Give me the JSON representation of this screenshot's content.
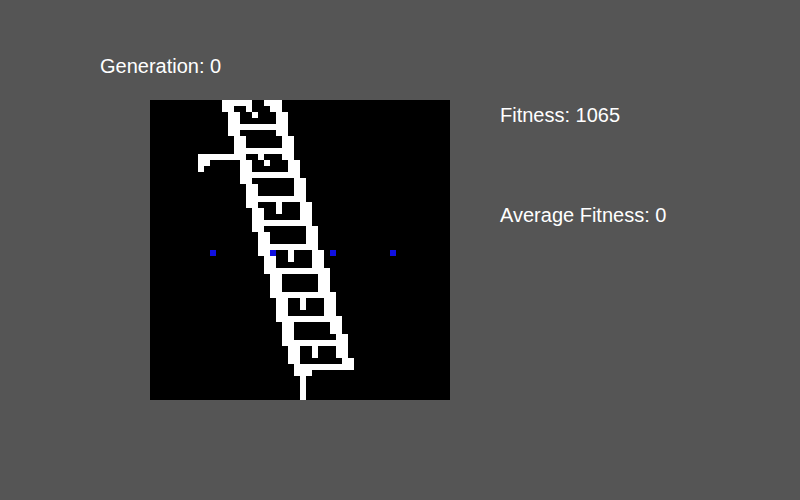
{
  "header": {
    "generation": "Generation: 0"
  },
  "stats": {
    "fitness": "Fitness: 1065",
    "average_fitness": "Average Fitness: 0"
  },
  "canvas": {
    "cell": 6,
    "structure": {
      "rows": [
        [
          [
            12,
            16
          ],
          [
            19,
            21
          ]
        ],
        [
          [
            12,
            13
          ],
          [
            16,
            16
          ],
          [
            20,
            21
          ]
        ],
        [
          [
            13,
            14
          ],
          [
            17,
            17
          ],
          [
            21,
            22
          ]
        ],
        [
          [
            13,
            14
          ],
          [
            21,
            22
          ]
        ],
        [
          [
            13,
            22
          ]
        ],
        [
          [
            13,
            14
          ],
          [
            21,
            22
          ]
        ],
        [
          [
            14,
            15
          ],
          [
            22,
            23
          ]
        ],
        [
          [
            14,
            15
          ],
          [
            22,
            23
          ]
        ],
        [
          [
            14,
            23
          ]
        ],
        [
          [
            8,
            15
          ],
          [
            18,
            18
          ],
          [
            22,
            23
          ]
        ],
        [
          [
            8,
            9
          ],
          [
            15,
            16
          ],
          [
            19,
            19
          ],
          [
            23,
            24
          ]
        ],
        [
          [
            8,
            8
          ],
          [
            15,
            16
          ],
          [
            23,
            24
          ]
        ],
        [
          [
            15,
            24
          ]
        ],
        [
          [
            15,
            16
          ],
          [
            24,
            25
          ]
        ],
        [
          [
            16,
            17
          ],
          [
            24,
            25
          ]
        ],
        [
          [
            16,
            17
          ],
          [
            24,
            25
          ]
        ],
        [
          [
            16,
            25
          ]
        ],
        [
          [
            16,
            17
          ],
          [
            21,
            21
          ],
          [
            25,
            26
          ]
        ],
        [
          [
            17,
            18
          ],
          [
            21,
            21
          ],
          [
            25,
            26
          ]
        ],
        [
          [
            17,
            18
          ],
          [
            25,
            26
          ]
        ],
        [
          [
            17,
            26
          ]
        ],
        [
          [
            17,
            18
          ],
          [
            26,
            27
          ]
        ],
        [
          [
            18,
            19
          ],
          [
            26,
            27
          ]
        ],
        [
          [
            18,
            19
          ],
          [
            26,
            27
          ]
        ],
        [
          [
            18,
            27
          ]
        ],
        [
          [
            18,
            19
          ],
          [
            23,
            23
          ],
          [
            27,
            28
          ]
        ],
        [
          [
            19,
            20
          ],
          [
            23,
            23
          ],
          [
            27,
            28
          ]
        ],
        [
          [
            19,
            20
          ],
          [
            27,
            28
          ]
        ],
        [
          [
            19,
            29
          ]
        ],
        [
          [
            20,
            21
          ],
          [
            28,
            29
          ]
        ],
        [
          [
            20,
            21
          ],
          [
            28,
            29
          ]
        ],
        [
          [
            20,
            21
          ],
          [
            28,
            29
          ]
        ],
        [
          [
            20,
            30
          ]
        ],
        [
          [
            21,
            22
          ],
          [
            25,
            25
          ],
          [
            29,
            30
          ]
        ],
        [
          [
            21,
            22
          ],
          [
            25,
            25
          ],
          [
            29,
            30
          ]
        ],
        [
          [
            21,
            22
          ],
          [
            29,
            30
          ]
        ],
        [
          [
            21,
            31
          ]
        ],
        [
          [
            22,
            23
          ],
          [
            30,
            31
          ]
        ],
        [
          [
            22,
            23
          ],
          [
            30,
            31
          ]
        ],
        [
          [
            22,
            23
          ],
          [
            31,
            32
          ]
        ],
        [
          [
            22,
            32
          ]
        ],
        [
          [
            23,
            24
          ],
          [
            27,
            27
          ],
          [
            31,
            32
          ]
        ],
        [
          [
            23,
            24
          ],
          [
            27,
            27
          ],
          [
            31,
            32
          ]
        ],
        [
          [
            23,
            24
          ],
          [
            32,
            33
          ]
        ],
        [
          [
            24,
            33
          ]
        ],
        [
          [
            24,
            26
          ]
        ],
        [
          [
            25,
            25
          ]
        ],
        [
          [
            25,
            25
          ]
        ],
        [
          [
            25,
            25
          ]
        ],
        [
          [
            25,
            25
          ]
        ]
      ]
    },
    "targets": [
      {
        "col": 10,
        "row": 25,
        "color": "#1010e0"
      },
      {
        "col": 20,
        "row": 25,
        "color": "#1010e0"
      },
      {
        "col": 30,
        "row": 25,
        "color": "#1010e0"
      },
      {
        "col": 40,
        "row": 25,
        "color": "#1010e0"
      }
    ]
  }
}
